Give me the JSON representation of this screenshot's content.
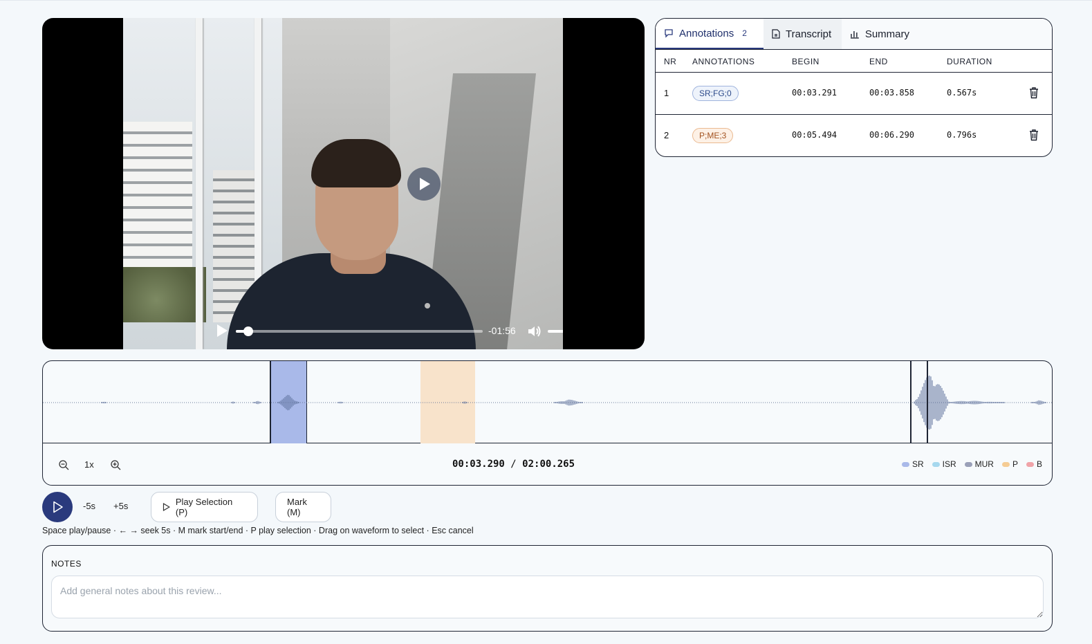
{
  "video": {
    "remaining": "-01:56",
    "progress": 0.03,
    "volume": 1.0
  },
  "tabs": [
    {
      "label": "Annotations",
      "count": "2",
      "icon": "comment-icon"
    },
    {
      "label": "Transcript",
      "icon": "document-icon"
    },
    {
      "label": "Summary",
      "icon": "bar-chart-icon"
    }
  ],
  "table": {
    "headers": [
      "NR",
      "ANNOTATIONS",
      "BEGIN",
      "END",
      "DURATION"
    ],
    "rows": [
      {
        "nr": "1",
        "tag": "SR;FG;0",
        "begin": "00:03.291",
        "end": "00:03.858",
        "duration": "0.567s"
      },
      {
        "nr": "2",
        "tag": "P;ME;3",
        "begin": "00:05.494",
        "end": "00:06.290",
        "duration": "0.796s"
      }
    ]
  },
  "waveform": {
    "zoom": "1x",
    "current": "00:03.290",
    "separator": "/",
    "total": "02:00.265",
    "legend": [
      {
        "label": "SR",
        "color": "#a9b9e9"
      },
      {
        "label": "ISR",
        "color": "#a6d8ee"
      },
      {
        "label": "MUR",
        "color": "#9aa0b8"
      },
      {
        "label": "P",
        "color": "#f5cc94"
      },
      {
        "label": "B",
        "color": "#f0a3a8"
      }
    ]
  },
  "transport": {
    "back": "-5s",
    "forward": "+5s",
    "play_selection": "Play Selection (P)",
    "mark": "Mark (M)",
    "hint": "Space play/pause · ← → seek 5s · M mark start/end · P play selection · Drag on waveform to select · Esc cancel"
  },
  "notes": {
    "label": "NOTES",
    "placeholder": "Add general notes about this review..."
  }
}
